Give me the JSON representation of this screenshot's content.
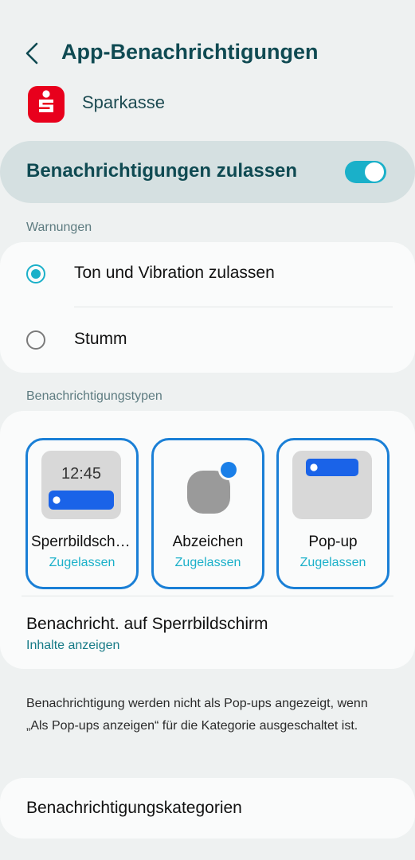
{
  "header": {
    "title": "App-Benachrichtigungen",
    "back_icon": "chevron-left-icon"
  },
  "app": {
    "name": "Sparkasse",
    "icon": "sparkasse-logo-icon",
    "icon_color": "#e8001c"
  },
  "master_toggle": {
    "label": "Benachrichtigungen zulassen",
    "on": true,
    "accent_color": "#1ab0c9"
  },
  "warnings": {
    "section_label": "Warnungen",
    "options": [
      {
        "label": "Ton und Vibration zulassen",
        "selected": true
      },
      {
        "label": "Stumm",
        "selected": false
      }
    ]
  },
  "types": {
    "section_label": "Benachrichtigungstypen",
    "tiles": [
      {
        "label": "Sperrbildschirm",
        "status": "Zugelassen",
        "preview_time": "12:45"
      },
      {
        "label": "Abzeichen",
        "status": "Zugelassen"
      },
      {
        "label": "Pop-up",
        "status": "Zugelassen"
      }
    ],
    "lockscreen_setting": {
      "title": "Benachricht. auf Sperrbildschirm",
      "value": "Inhalte anzeigen"
    }
  },
  "info": "Benachrichtigung werden nicht als Pop-ups angezeigt, wenn „Als Pop-ups anzeigen“ für die Kategorie ausgeschaltet ist.",
  "categories": {
    "label": "Benachrichtigungskategorien"
  }
}
